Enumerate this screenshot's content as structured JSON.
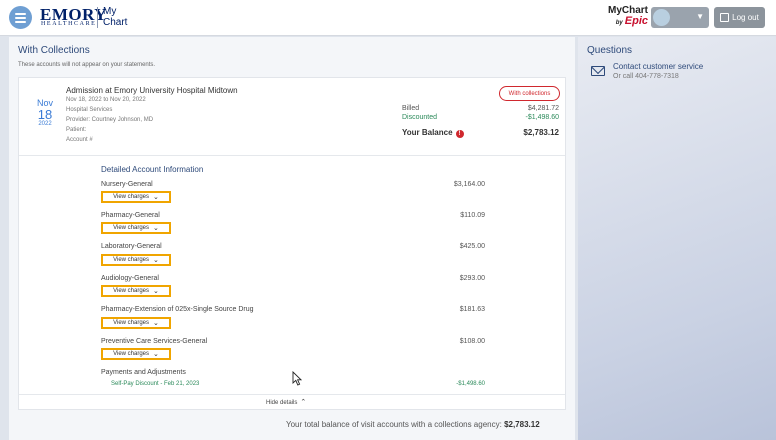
{
  "header": {
    "logo_emory": "EMORY",
    "logo_healthcare": "HEALTHCARE",
    "logo_mychart_line1": "My",
    "logo_mychart_line2": "Chart",
    "epic_mychart": "MyChart",
    "epic_by": "by",
    "epic_name": "Epic",
    "logout_label": "Log out",
    "icons": [
      "menu-icon",
      "chevron-down-icon",
      "logout-icon"
    ]
  },
  "collections": {
    "title": "With Collections",
    "subtitle": "These accounts will not appear on your statements.",
    "visit": {
      "month": "Nov",
      "day": "18",
      "year": "2022",
      "title": "Admission at Emory University Hospital Midtown",
      "dates": "Nov 18, 2022 to Nov 20, 2022",
      "service": "Hospital Services",
      "provider": "Provider: Courtney Johnson, MD",
      "patient": "Patient:",
      "account": "Account #",
      "badge": "With collections",
      "billed_label": "Billed",
      "billed_value": "$4,281.72",
      "discounted_label": "Discounted",
      "discounted_value": "-$1,498.60",
      "balance_label": "Your Balance",
      "balance_alert": "!",
      "balance_value": "$2,783.12"
    },
    "details": {
      "title": "Detailed Account Information",
      "view_label": "View charges",
      "lines": [
        {
          "name": "Nursery-General",
          "amount": "$3,164.00"
        },
        {
          "name": "Pharmacy-General",
          "amount": "$110.09"
        },
        {
          "name": "Laboratory-General",
          "amount": "$425.00"
        },
        {
          "name": "Audiology-General",
          "amount": "$293.00"
        },
        {
          "name": "Pharmacy-Extension of 025x-Single Source Drug",
          "amount": "$181.63"
        },
        {
          "name": "Preventive Care Services-General",
          "amount": "$108.00"
        }
      ],
      "payments_title": "Payments and Adjustments",
      "payment_line": "Self-Pay Discount - Feb 21, 2023",
      "payment_amount": "-$1,498.60",
      "hide_label": "Hide details"
    },
    "total_text": "Your total balance of visit accounts with a collections agency:",
    "total_value": "$2,783.12"
  },
  "questions": {
    "title": "Questions",
    "contact_link": "Contact customer service",
    "contact_call": "Or call 404-778-7318"
  },
  "colors": {
    "accent": "#2e4a7a",
    "highlight": "#f0a500",
    "alert": "#d0282e",
    "discount": "#2b8a5a"
  }
}
